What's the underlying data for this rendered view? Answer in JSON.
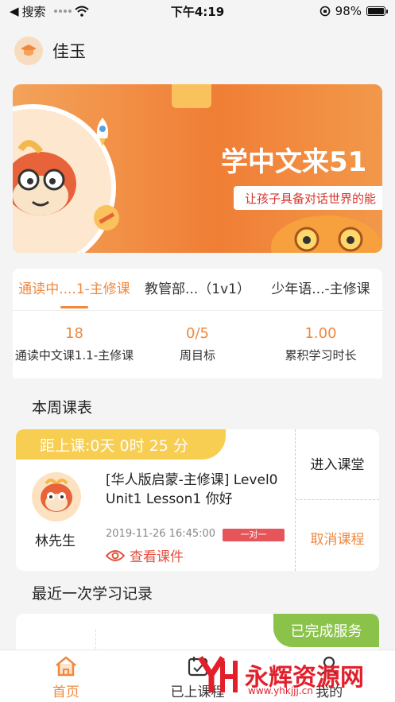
{
  "status_bar": {
    "back_app": "搜索",
    "time": "下午4:19",
    "battery": "98%",
    "battery_level": 0.98
  },
  "header": {
    "name": "佳玉"
  },
  "banner": {
    "headline": "学中文来51",
    "subline": "让孩子具备对话世界的能"
  },
  "course_tabs": [
    {
      "label": "通读中....1-主修课",
      "active": true
    },
    {
      "label": "教管部...（1v1）",
      "active": false
    },
    {
      "label": "少年语...-主修课",
      "active": false
    }
  ],
  "stats": [
    {
      "value": "18",
      "label": "通读中文课1.1-主修课"
    },
    {
      "value": "0/5",
      "label": "周目标"
    },
    {
      "value": "1.00",
      "label": "累积学习时长"
    }
  ],
  "schedule": {
    "title": "本周课表",
    "countdown": "距上课:0天 0时 25 分",
    "teacher_name": "林先生",
    "course_title": "[华人版启蒙-主修课] Level0 Unit1 Lesson1 你好",
    "time": "2019-11-26 16:45:00",
    "type_badge": "一对一",
    "view_materials": "查看课件",
    "enter_class": "进入课堂",
    "cancel_class": "取消课程"
  },
  "record": {
    "title": "最近一次学习记录",
    "badge": "已完成服务"
  },
  "tabbar": [
    {
      "label": "首页",
      "icon": "home-icon",
      "active": true
    },
    {
      "label": "已上课程",
      "icon": "calendar-icon",
      "active": false
    },
    {
      "label": "我的",
      "icon": "user-icon",
      "active": false
    }
  ],
  "watermark": {
    "text": "永辉资源网",
    "url": "www.yhkjjj.cn"
  },
  "colors": {
    "accent": "#f0883e",
    "countdown_bg": "#f7ce52",
    "done_badge": "#8bc34a",
    "badge_red": "#e7545a"
  }
}
